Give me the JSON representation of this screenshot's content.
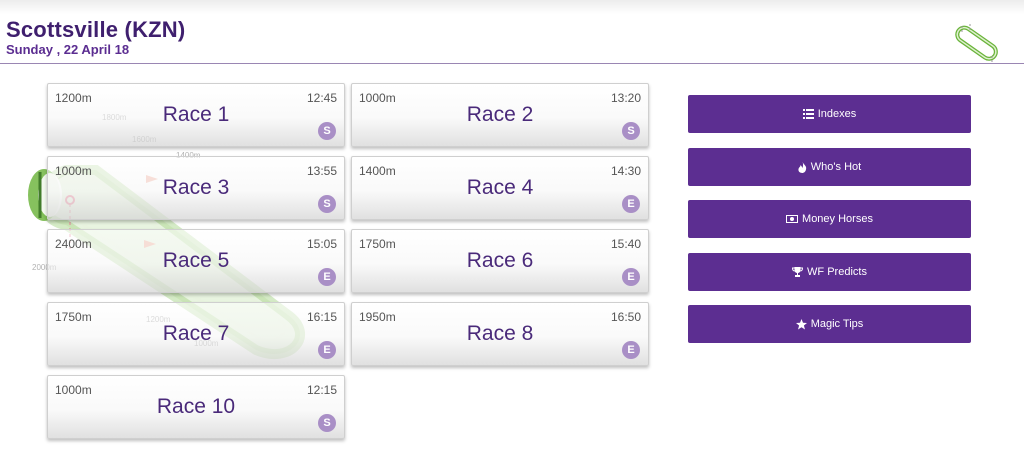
{
  "header": {
    "venue": "Scottsville (KZN)",
    "date": "Sunday , 22 April 18"
  },
  "track_map": {
    "labels": [
      "1800m",
      "1600m",
      "1400m",
      "2000m",
      "1200m",
      "1000m"
    ]
  },
  "races": [
    {
      "name": "Race 1",
      "distance": "1200m",
      "time": "12:45",
      "badge": "S"
    },
    {
      "name": "Race 2",
      "distance": "1000m",
      "time": "13:20",
      "badge": "S"
    },
    {
      "name": "Race 3",
      "distance": "1000m",
      "time": "13:55",
      "badge": "S"
    },
    {
      "name": "Race 4",
      "distance": "1400m",
      "time": "14:30",
      "badge": "E"
    },
    {
      "name": "Race 5",
      "distance": "2400m",
      "time": "15:05",
      "badge": "E"
    },
    {
      "name": "Race 6",
      "distance": "1750m",
      "time": "15:40",
      "badge": "E"
    },
    {
      "name": "Race 7",
      "distance": "1750m",
      "time": "16:15",
      "badge": "E"
    },
    {
      "name": "Race 8",
      "distance": "1950m",
      "time": "16:50",
      "badge": "E"
    },
    {
      "name": "Race 10",
      "distance": "1000m",
      "time": "12:15",
      "badge": "S"
    }
  ],
  "menu": [
    {
      "label": "Indexes",
      "icon": "list-icon"
    },
    {
      "label": "Who's Hot",
      "icon": "fire-icon"
    },
    {
      "label": "Money Horses",
      "icon": "money-icon"
    },
    {
      "label": "WF Predicts",
      "icon": "trophy-icon"
    },
    {
      "label": "Magic Tips",
      "icon": "star-icon"
    }
  ],
  "colors": {
    "brand_purple": "#5c2e91",
    "title_purple": "#3f1f6e",
    "badge_purple": "#a98fc6",
    "track_green": "#6ab43a"
  }
}
